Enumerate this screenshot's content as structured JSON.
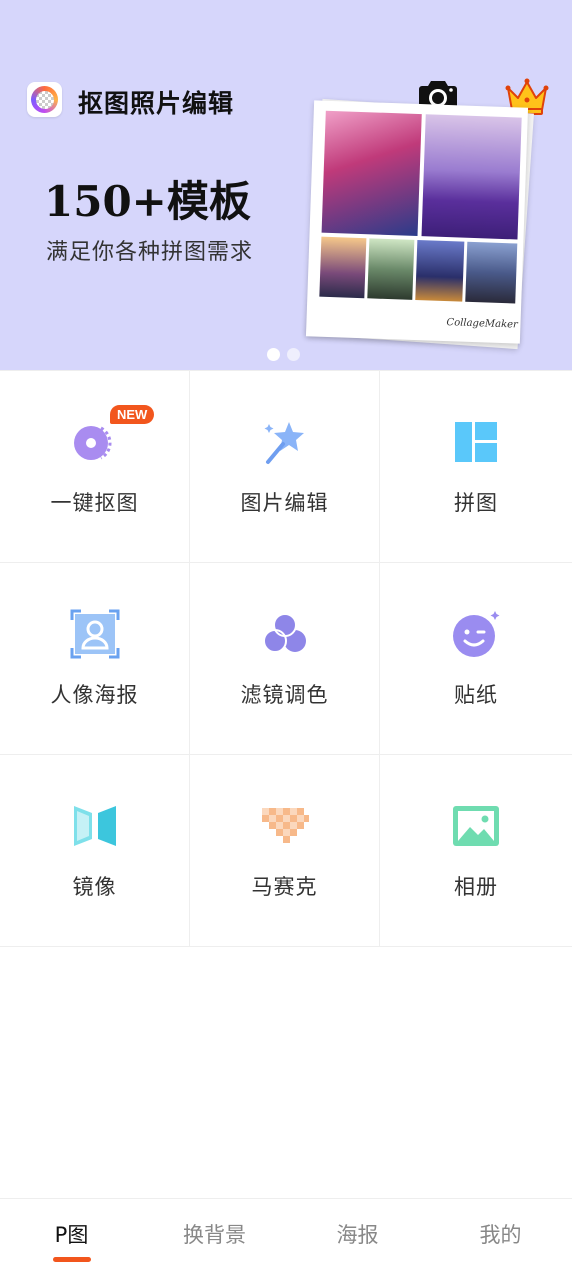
{
  "banner": {
    "app_title": "抠图照片编辑",
    "headline": "150+模板",
    "subline": "满足你各种拼图需求",
    "collage_caption": "CollageMaker",
    "background_color": "#d6d6fb",
    "page_indicator": {
      "count": 2,
      "active": 1
    }
  },
  "features": [
    [
      {
        "label": "一键抠图",
        "icon": "cutout-icon",
        "badge": "NEW"
      },
      {
        "label": "图片编辑",
        "icon": "magic-wand-icon"
      },
      {
        "label": "拼图",
        "icon": "collage-layout-icon"
      }
    ],
    [
      {
        "label": "人像海报",
        "icon": "portrait-icon"
      },
      {
        "label": "滤镜调色",
        "icon": "filter-icon"
      },
      {
        "label": "贴纸",
        "icon": "sticker-icon"
      }
    ],
    [
      {
        "label": "镜像",
        "icon": "mirror-icon"
      },
      {
        "label": "马赛克",
        "icon": "mosaic-icon"
      },
      {
        "label": "相册",
        "icon": "album-icon"
      }
    ]
  ],
  "bottom_nav": {
    "items": [
      "P图",
      "换背景",
      "海报",
      "我的"
    ],
    "active_index": 0,
    "accent_color": "#f2561d"
  }
}
